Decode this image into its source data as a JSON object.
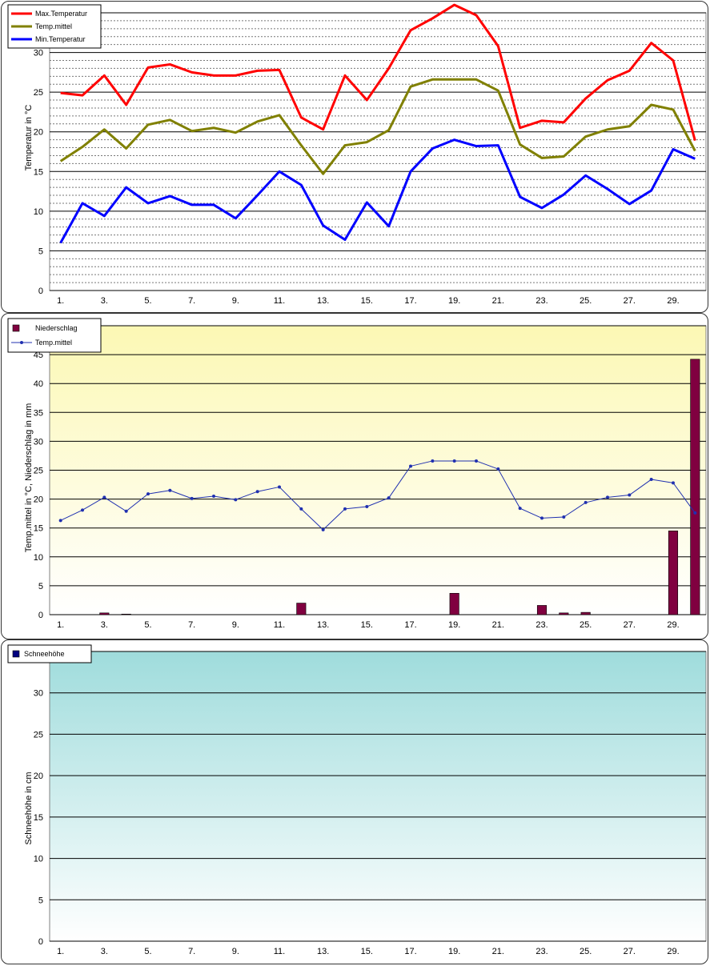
{
  "chart_data": [
    {
      "type": "line",
      "title": "",
      "xlabel": "",
      "ylabel": "Temperatur  in °C",
      "ylim": [
        0,
        35
      ],
      "y_ticks": [
        "0",
        "5",
        "10",
        "15",
        "20",
        "25",
        "30"
      ],
      "x_ticks": [
        "1.",
        "3.",
        "5.",
        "7.",
        "9.",
        "11.",
        "13.",
        "15.",
        "17.",
        "19.",
        "21.",
        "23.",
        "25.",
        "27.",
        "29."
      ],
      "x": [
        1,
        2,
        3,
        4,
        5,
        6,
        7,
        8,
        9,
        10,
        11,
        12,
        13,
        14,
        15,
        16,
        17,
        18,
        19,
        20,
        21,
        22,
        23,
        24,
        25,
        26,
        27,
        28,
        29,
        30
      ],
      "grid": true,
      "legend_position": "top-left",
      "series": [
        {
          "name": "Max.Temperatur",
          "color": "#ff0000",
          "values": [
            24.9,
            24.6,
            27.1,
            23.4,
            28.1,
            28.5,
            27.5,
            27.1,
            27.1,
            27.7,
            27.8,
            21.8,
            20.3,
            27.1,
            24.0,
            28.0,
            32.8,
            34.3,
            36.0,
            34.7,
            30.8,
            20.5,
            21.4,
            21.2,
            24.2,
            26.5,
            27.7,
            31.2,
            29.0,
            18.9
          ]
        },
        {
          "name": "Temp.mittel",
          "color": "#808000",
          "values": [
            16.3,
            18.1,
            20.3,
            17.9,
            20.9,
            21.5,
            20.1,
            20.5,
            19.9,
            21.3,
            22.1,
            18.3,
            14.7,
            18.3,
            18.7,
            20.2,
            25.7,
            26.6,
            26.6,
            26.6,
            25.2,
            18.4,
            16.7,
            16.9,
            19.4,
            20.3,
            20.7,
            23.4,
            22.8,
            17.6
          ]
        },
        {
          "name": "Min.Temperatur",
          "color": "#0000ff",
          "values": [
            6.0,
            11.0,
            9.4,
            13.0,
            11.0,
            11.9,
            10.8,
            10.8,
            9.1,
            12.0,
            15.0,
            13.3,
            8.2,
            6.4,
            11.1,
            8.1,
            15.0,
            17.9,
            19.0,
            18.2,
            18.3,
            11.8,
            10.4,
            12.1,
            14.5,
            12.8,
            10.9,
            12.6,
            17.8,
            16.6
          ]
        }
      ]
    },
    {
      "type": "bar",
      "title": "",
      "xlabel": "",
      "ylabel": "Temp.mittel  in °C, Niederschlag in mm",
      "ylim": [
        0,
        50
      ],
      "y_ticks": [
        "0",
        "5",
        "10",
        "15",
        "20",
        "25",
        "30",
        "35",
        "40",
        "45"
      ],
      "x_ticks": [
        "1.",
        "3.",
        "5.",
        "7.",
        "9.",
        "11.",
        "13.",
        "15.",
        "17.",
        "19.",
        "21.",
        "23.",
        "25.",
        "27.",
        "29."
      ],
      "x": [
        1,
        2,
        3,
        4,
        5,
        6,
        7,
        8,
        9,
        10,
        11,
        12,
        13,
        14,
        15,
        16,
        17,
        18,
        19,
        20,
        21,
        22,
        23,
        24,
        25,
        26,
        27,
        28,
        29,
        30
      ],
      "grid": true,
      "legend_position": "top-left",
      "background": [
        "#fcf8b4",
        "#ffffff"
      ],
      "series": [
        {
          "name": "Niederschlag",
          "type": "bar",
          "color": "#800040",
          "values": [
            0,
            0,
            0.3,
            0.1,
            0,
            0,
            0,
            0,
            0,
            0,
            0,
            2.0,
            0,
            0,
            0,
            0,
            0,
            0,
            3.7,
            0,
            0,
            0,
            1.6,
            0.3,
            0.4,
            0,
            0,
            0,
            14.5,
            44.2
          ]
        },
        {
          "name": "Temp.mittel",
          "type": "line",
          "color": "#2030b0",
          "values": [
            16.3,
            18.1,
            20.3,
            17.9,
            20.9,
            21.5,
            20.1,
            20.5,
            19.9,
            21.3,
            22.1,
            18.3,
            14.7,
            18.3,
            18.7,
            20.2,
            25.7,
            26.6,
            26.6,
            26.6,
            25.2,
            18.4,
            16.7,
            16.9,
            19.4,
            20.3,
            20.7,
            23.4,
            22.8,
            17.6
          ]
        }
      ]
    },
    {
      "type": "bar",
      "title": "",
      "xlabel": "",
      "ylabel": "Schneehöhe in cm",
      "ylim": [
        0,
        35
      ],
      "y_ticks": [
        "0",
        "5",
        "10",
        "15",
        "20",
        "25",
        "30"
      ],
      "x_ticks": [
        "1.",
        "3.",
        "5.",
        "7.",
        "9.",
        "11.",
        "13.",
        "15.",
        "17.",
        "19.",
        "21.",
        "23.",
        "25.",
        "27.",
        "29."
      ],
      "x": [
        1,
        2,
        3,
        4,
        5,
        6,
        7,
        8,
        9,
        10,
        11,
        12,
        13,
        14,
        15,
        16,
        17,
        18,
        19,
        20,
        21,
        22,
        23,
        24,
        25,
        26,
        27,
        28,
        29,
        30
      ],
      "grid": true,
      "legend_position": "top-left",
      "background": [
        "#9fdcdc",
        "#ffffff"
      ],
      "series": [
        {
          "name": "Schneehöhe",
          "type": "bar",
          "color": "#000080",
          "values": [
            0,
            0,
            0,
            0,
            0,
            0,
            0,
            0,
            0,
            0,
            0,
            0,
            0,
            0,
            0,
            0,
            0,
            0,
            0,
            0,
            0,
            0,
            0,
            0,
            0,
            0,
            0,
            0,
            0,
            0
          ]
        }
      ]
    }
  ]
}
